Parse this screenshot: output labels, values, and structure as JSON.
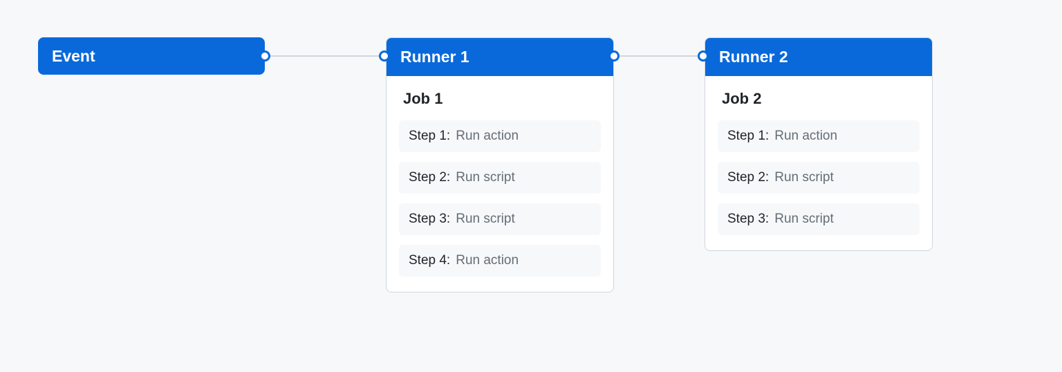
{
  "event": {
    "title": "Event"
  },
  "runners": [
    {
      "title": "Runner 1",
      "job": "Job 1",
      "steps": [
        {
          "label": "Step 1:",
          "desc": "Run action"
        },
        {
          "label": "Step 2:",
          "desc": "Run script"
        },
        {
          "label": "Step 3:",
          "desc": "Run script"
        },
        {
          "label": "Step 4:",
          "desc": "Run action"
        }
      ]
    },
    {
      "title": "Runner 2",
      "job": "Job 2",
      "steps": [
        {
          "label": "Step 1:",
          "desc": "Run action"
        },
        {
          "label": "Step 2:",
          "desc": "Run script"
        },
        {
          "label": "Step 3:",
          "desc": "Run script"
        }
      ]
    }
  ]
}
